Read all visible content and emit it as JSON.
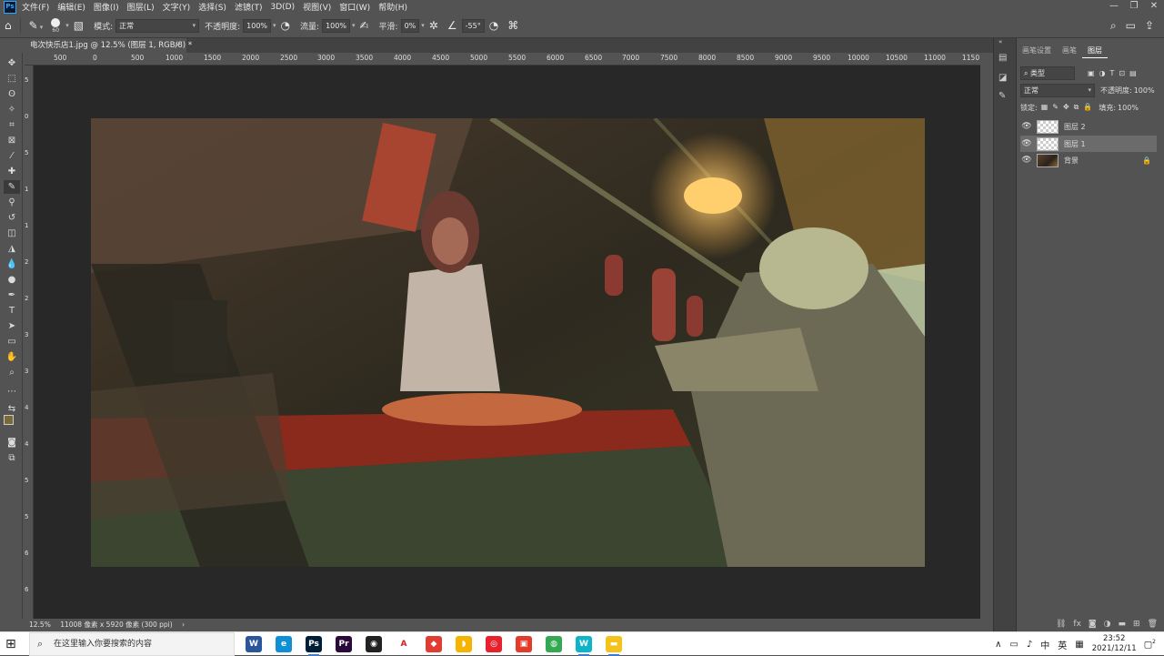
{
  "app": {
    "logo": "Ps"
  },
  "menu": [
    "文件(F)",
    "编辑(E)",
    "图像(I)",
    "图层(L)",
    "文字(Y)",
    "选择(S)",
    "滤镜(T)",
    "3D(D)",
    "视图(V)",
    "窗口(W)",
    "帮助(H)"
  ],
  "window_controls": [
    "—",
    "❐",
    "✕"
  ],
  "options": {
    "brush_size": "60",
    "mode_label": "模式:",
    "mode_value": "正常",
    "opacity_label": "不透明度:",
    "opacity_value": "100%",
    "flow_label": "流量:",
    "flow_value": "100%",
    "smooth_label": "平滑:",
    "smooth_value": "0%",
    "angle_value": "-55°"
  },
  "document": {
    "tab_title": "电次快乐店1.jpg @ 12.5% (图层 1, RGB/8) *",
    "close": "×"
  },
  "ruler": {
    "top_labels": [
      "500",
      "0",
      "500",
      "1000",
      "1500",
      "2000",
      "2500",
      "3000",
      "3500",
      "4000",
      "4500",
      "5000",
      "5500",
      "6000",
      "6500",
      "7000",
      "7500",
      "8000",
      "8500",
      "9000",
      "9500",
      "10000",
      "10500",
      "11000",
      "1150"
    ],
    "left_labels": [
      "5",
      "0",
      "5",
      "1",
      "1",
      "2",
      "2",
      "3",
      "3",
      "4",
      "4",
      "5",
      "5",
      "6",
      "6"
    ]
  },
  "status": {
    "zoom": "12.5%",
    "dimensions": "11008 像素 x 5920 像素 (300 ppi)",
    "arrow": "›"
  },
  "panels": {
    "tabs": [
      "画笔设置",
      "画笔",
      "图层"
    ],
    "filter_value": "类型",
    "blend_mode": "正常",
    "opacity_label": "不透明度:",
    "opacity_value": "100%",
    "lock_label": "锁定:",
    "fill_label": "填充:",
    "fill_value": "100%",
    "layers": [
      {
        "name": "图层 2"
      },
      {
        "name": "图层 1"
      },
      {
        "name": "背景"
      }
    ]
  },
  "taskbar": {
    "search_placeholder": "在这里输入你要搜索的内容",
    "apps": [
      {
        "label": "W",
        "color": "#2b579a"
      },
      {
        "label": "e",
        "color": "#0f8fd6"
      },
      {
        "label": "Ps",
        "color": "#001e36"
      },
      {
        "label": "Pr",
        "color": "#2a0a3a"
      },
      {
        "label": "◉",
        "color": "#222222"
      },
      {
        "label": "A",
        "color": "#ffffff"
      },
      {
        "label": "◆",
        "color": "#e03c31"
      },
      {
        "label": "◗",
        "color": "#f5b400"
      },
      {
        "label": "◎",
        "color": "#e8212f"
      },
      {
        "label": "▣",
        "color": "#e33a2a"
      },
      {
        "label": "◍",
        "color": "#34a853"
      },
      {
        "label": "W",
        "color": "#10b4c8"
      },
      {
        "label": "▬",
        "color": "#f3c21b"
      }
    ],
    "tray_icons": [
      "∧",
      "▭",
      "♪",
      "中",
      "英",
      "▦"
    ],
    "time": "23:52",
    "date": "2021/12/11",
    "notification": "2"
  }
}
